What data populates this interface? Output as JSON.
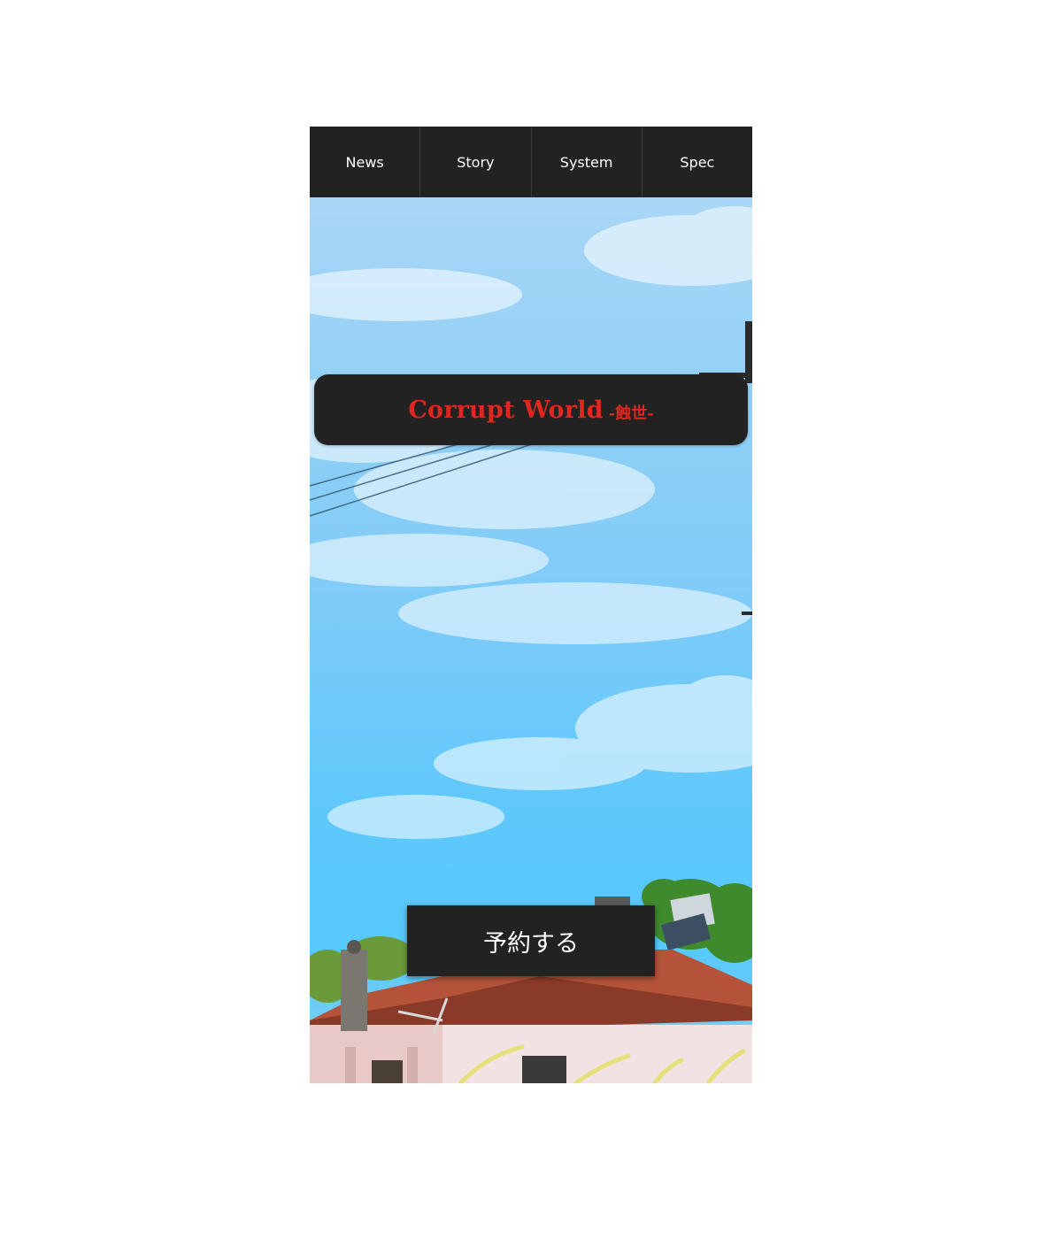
{
  "nav": {
    "items": [
      {
        "label": "News"
      },
      {
        "label": "Story"
      },
      {
        "label": "System"
      },
      {
        "label": "Spec"
      }
    ]
  },
  "hero": {
    "title": "Corrupt World",
    "subtitle": "-蝕世-",
    "reserve_label": "予約する"
  },
  "colors": {
    "nav_bg": "#222222",
    "title_red": "#e0261e",
    "button_bg": "#222222",
    "sky": "#5ec8fb"
  }
}
